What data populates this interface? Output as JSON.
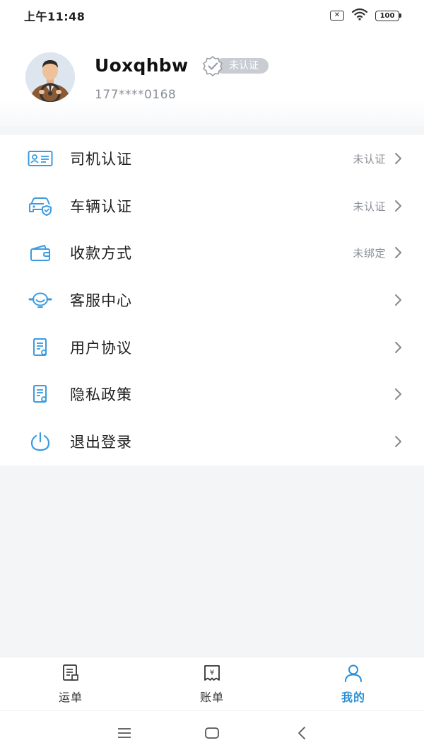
{
  "status_bar": {
    "time": "上午11:48",
    "sim_label": "✕",
    "battery": "100"
  },
  "profile": {
    "username": "Uoxqhbw",
    "badge": "未认证",
    "phone": "177****0168"
  },
  "colors": {
    "accent": "#2a8fd6",
    "icon_blue": "#3b9be0",
    "muted": "#8a8f96"
  },
  "menu": {
    "items": [
      {
        "icon": "id-card-icon",
        "label": "司机认证",
        "status": "未认证"
      },
      {
        "icon": "car-shield-icon",
        "label": "车辆认证",
        "status": "未认证"
      },
      {
        "icon": "wallet-icon",
        "label": "收款方式",
        "status": "未绑定"
      },
      {
        "icon": "headset-icon",
        "label": "客服中心",
        "status": ""
      },
      {
        "icon": "document-icon",
        "label": "用户协议",
        "status": ""
      },
      {
        "icon": "document-icon",
        "label": "隐私政策",
        "status": ""
      },
      {
        "icon": "power-icon",
        "label": "退出登录",
        "status": ""
      }
    ]
  },
  "tabbar": {
    "tabs": [
      {
        "icon": "waybill-icon",
        "label": "运单",
        "active": false
      },
      {
        "icon": "bill-icon",
        "label": "账单",
        "active": false
      },
      {
        "icon": "user-icon",
        "label": "我的",
        "active": true
      }
    ]
  }
}
